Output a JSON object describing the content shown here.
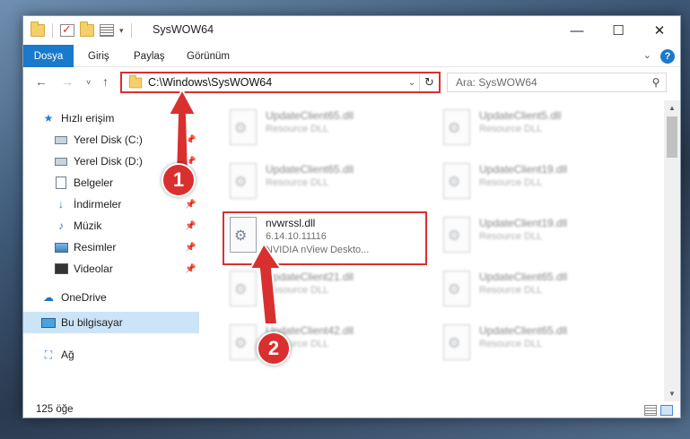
{
  "window": {
    "title": "SysWOW64",
    "controls": {
      "minimize": "—",
      "maximize": "☐",
      "close": "✕"
    }
  },
  "quick_access_toolbar": {
    "icons": [
      "folder-icon",
      "properties-check-icon",
      "new-folder-icon",
      "properties-list-icon",
      "customize-dropdown-icon"
    ],
    "dropdown_glyph": "▾"
  },
  "ribbon": {
    "tabs": [
      {
        "label": "Dosya",
        "active": true
      },
      {
        "label": "Giriş"
      },
      {
        "label": "Paylaş"
      },
      {
        "label": "Görünüm"
      }
    ],
    "expand_glyph": "⌄",
    "help_glyph": "?"
  },
  "navigation": {
    "back_glyph": "←",
    "forward_glyph": "→",
    "recent_glyph": "˅",
    "up_glyph": "↑",
    "address": "C:\\Windows\\SysWOW64",
    "address_dropdown_glyph": "⌄",
    "refresh_glyph": "↻",
    "search_placeholder": "Ara: SysWOW64",
    "search_glyph": "⚲"
  },
  "sidebar": {
    "items": [
      {
        "label": "Hızlı erişim",
        "icon": "star-icon",
        "glyph": "★"
      },
      {
        "label": "Yerel Disk (C:)",
        "icon": "drive-icon",
        "pinned": true
      },
      {
        "label": "Yerel Disk (D:)",
        "icon": "drive-icon",
        "pinned": true
      },
      {
        "label": "Belgeler",
        "icon": "documents-icon",
        "pinned": true
      },
      {
        "label": "İndirmeler",
        "icon": "download-icon",
        "glyph": "↓",
        "pinned": true
      },
      {
        "label": "Müzik",
        "icon": "music-icon",
        "glyph": "♪",
        "pinned": true
      },
      {
        "label": "Resimler",
        "icon": "pictures-icon",
        "pinned": true
      },
      {
        "label": "Videolar",
        "icon": "videos-icon",
        "pinned": true
      },
      {
        "label": "OneDrive",
        "icon": "cloud-icon",
        "glyph": "☁"
      },
      {
        "label": "Bu bilgisayar",
        "icon": "computer-icon",
        "selected": true
      },
      {
        "label": "Ağ",
        "icon": "network-icon",
        "glyph": "⛶"
      }
    ],
    "pin_glyph": "📌"
  },
  "files": [
    {
      "name": "UpdateClient65.dll",
      "line2": "Resource DLL",
      "blurred": true
    },
    {
      "name": "UpdateClient5.dll",
      "line2": "Resource DLL",
      "blurred": true
    },
    {
      "name": "UpdateClient65.dll",
      "line2": "Resource DLL",
      "blurred": true
    },
    {
      "name": "UpdateClient19.dll",
      "line2": "Resource DLL",
      "blurred": true
    },
    {
      "name": "nvwrssl.dll",
      "line2": "6.14.10.11116",
      "line3": "NVIDIA nView Deskto...",
      "blurred": false,
      "highlighted": true
    },
    {
      "name": "UpdateClient19.dll",
      "line2": "Resource DLL",
      "blurred": true
    },
    {
      "name": "UpdateClient21.dll",
      "line2": "Resource DLL",
      "blurred": true
    },
    {
      "name": "UpdateClient65.dll",
      "line2": "Resource DLL",
      "blurred": true
    },
    {
      "name": "UpdateClient42.dll",
      "line2": "Resource DLL",
      "blurred": true
    },
    {
      "name": "UpdateClient65.dll",
      "line2": "Resource DLL",
      "blurred": true
    }
  ],
  "status": {
    "item_count": "125 öğe"
  },
  "annotations": {
    "badge1": "1",
    "badge2": "2",
    "color": "#d9302f"
  }
}
